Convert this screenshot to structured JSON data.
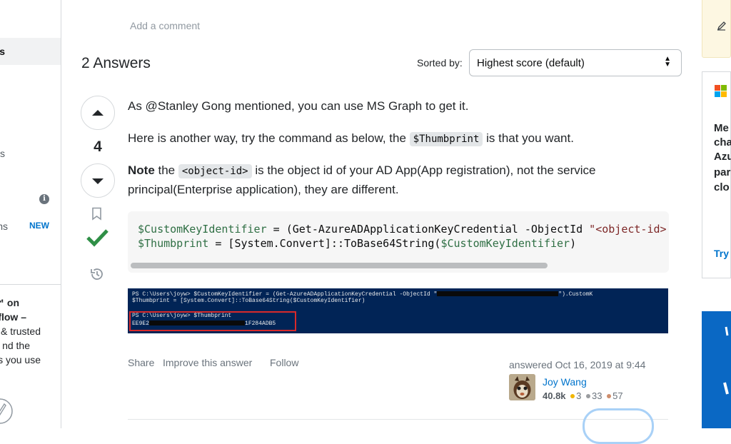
{
  "left_sidebar": {
    "active_item_fragment": "s",
    "item_fragment_1": "es",
    "item_fragment_2": "ns",
    "new_badge": "NEW",
    "info_icon_glyph": "i",
    "promo_lines": [
      "™ on",
      "flow –",
      "& trusted",
      "nd the",
      "s you use"
    ]
  },
  "question": {
    "add_comment": "Add a comment"
  },
  "answers_header": {
    "title": "2 Answers",
    "sorted_by_label": "Sorted by:",
    "sort_selected": "Highest score (default)"
  },
  "answer": {
    "vote_count": "4",
    "p1": "As @Stanley Gong mentioned, you can use MS Graph to get it.",
    "p2_before": "Here is another way, try the command as below, the ",
    "p2_code": "$Thumbprint",
    "p2_after": " is that you want.",
    "p3_bold": "Note",
    "p3_before": " the ",
    "p3_code": "<object-id>",
    "p3_after": " is the object id of your AD App(App registration), not the service principal(Enterprise application), they are different.",
    "code_line1_var": "$CustomKeyIdentifier",
    "code_line1_mid": " = (Get-AzureADApplicationKeyCredential -ObjectId ",
    "code_line1_str": "\"<object-id>",
    "code_line2_var": "$Thumbprint",
    "code_line2_mid": " = [System.Convert]::ToBase64String(",
    "code_line2_arg": "$CustomKeyIdentifier",
    "code_line2_end": ")",
    "ps_line1_a": "PS C:\\Users\\joyw> $CustomKeyIdentifier = (Get-AzureADApplicationKeyCredential -ObjectId \"",
    "ps_line1_b": "\").CustomK",
    "ps_line2": "$Thumbprint = [System.Convert]::ToBase64String($CustomKeyIdentifier)",
    "ps_line3": "PS C:\\Users\\joyw> $Thumbprint",
    "ps_line4_a": "EE9E2",
    "ps_line4_b": "1F284ADB5",
    "actions": {
      "share": "Share",
      "improve": "Improve this answer",
      "follow": "Follow"
    },
    "answered": "answered Oct 16, 2019 at 9:44",
    "user": {
      "name": "Joy Wang",
      "reputation": "40.8k",
      "gold": "3",
      "silver": "33",
      "bronze": "57"
    }
  },
  "right_sidebar": {
    "ad_lines": [
      "Me",
      "cha",
      "Azu",
      "par",
      "clo"
    ],
    "try_label": "Try"
  },
  "colors": {
    "accent": "#0074cc",
    "accepted_green": "#2f8f46",
    "powershell_bg": "#012456",
    "highlight_red": "#d92a2a"
  },
  "icons": [
    "arrow-up-icon",
    "arrow-down-icon",
    "bookmark-icon",
    "checkmark-icon",
    "history-icon",
    "info-icon",
    "microsoft-logo-icon",
    "pencil-icon",
    "chevron-updown-icon"
  ]
}
